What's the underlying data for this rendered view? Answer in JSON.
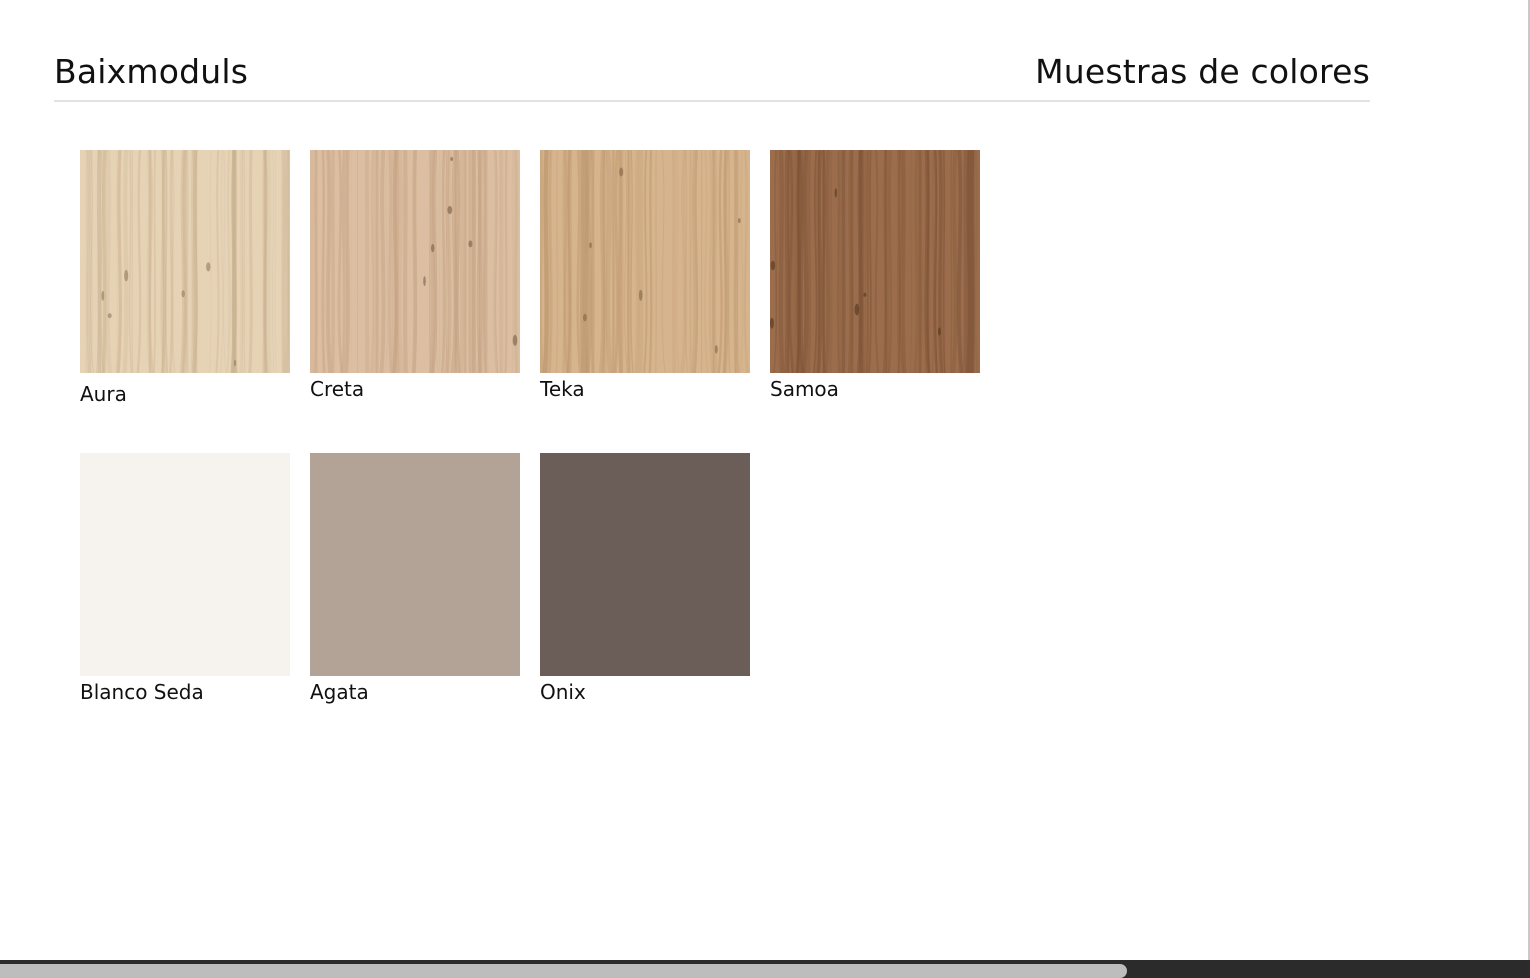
{
  "header": {
    "brand": "Baixmoduls",
    "section_title": "Muestras de colores"
  },
  "swatches": [
    {
      "name": "Aura",
      "texture": "wood",
      "colors": {
        "base": "#e6d3b6",
        "grain": "#cbb391",
        "dark": "#8a7256"
      }
    },
    {
      "name": "Creta",
      "texture": "wood",
      "colors": {
        "base": "#dcbfa2",
        "grain": "#c4a283",
        "dark": "#6e5440"
      }
    },
    {
      "name": "Teka",
      "texture": "wood",
      "colors": {
        "base": "#d6b48d",
        "grain": "#bd9870",
        "dark": "#7a5c3f"
      }
    },
    {
      "name": "Samoa",
      "texture": "wood",
      "colors": {
        "base": "#9b6d4c",
        "grain": "#7d5337",
        "dark": "#4a2f1d"
      }
    },
    {
      "name": "Blanco Seda",
      "texture": "solid",
      "colors": {
        "base": "#f6f2ee"
      }
    },
    {
      "name": "Agata",
      "texture": "solid",
      "colors": {
        "base": "#b3a396"
      }
    },
    {
      "name": "Onix",
      "texture": "solid",
      "colors": {
        "base": "#6b5e59"
      }
    }
  ],
  "scrollbar": {
    "track_color": "#2b2b2b",
    "thumb_color": "#bdbdbd"
  }
}
